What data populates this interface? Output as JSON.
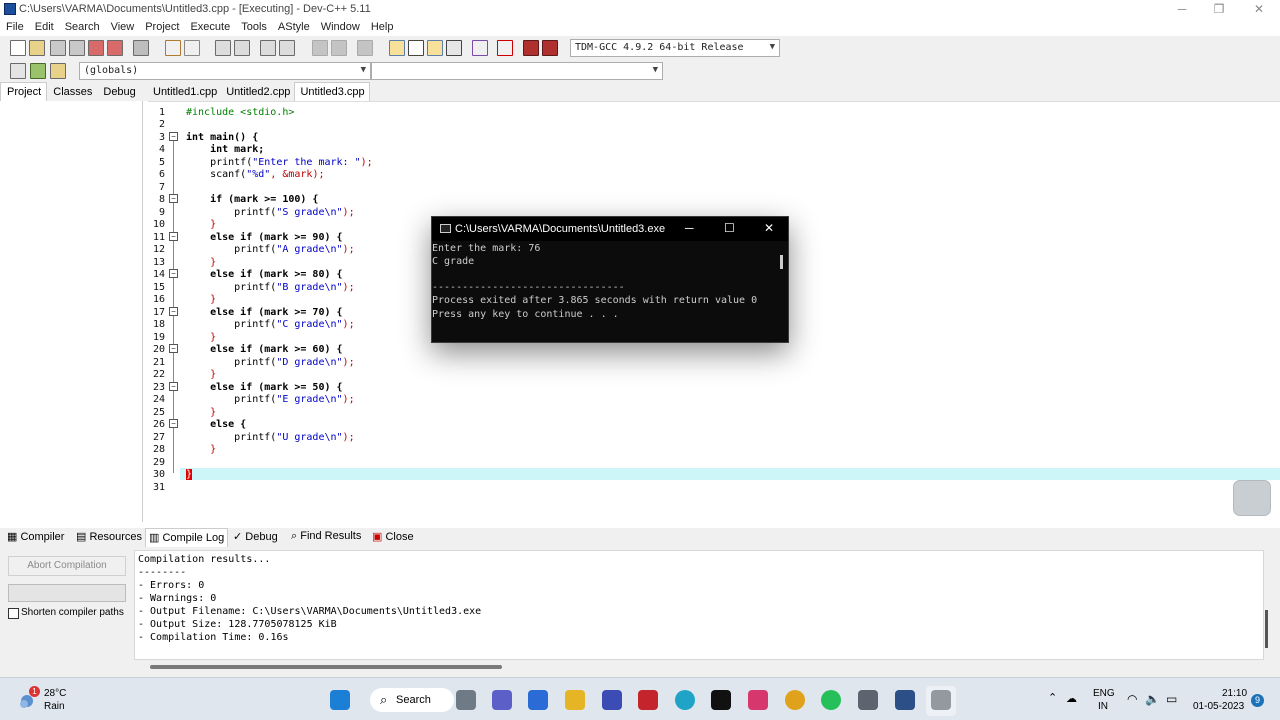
{
  "window": {
    "title": "C:\\Users\\VARMA\\Documents\\Untitled3.cpp - [Executing] - Dev-C++ 5.11",
    "minimize": "─",
    "maximize": "❐",
    "close": "✕"
  },
  "menu": [
    "File",
    "Edit",
    "Search",
    "View",
    "Project",
    "Execute",
    "Tools",
    "AStyle",
    "Window",
    "Help"
  ],
  "toolbar": {
    "compiler_select": "TDM-GCC 4.9.2 64-bit Release",
    "scope_select": "(globals)",
    "function_select": ""
  },
  "left_tabs": [
    "Project",
    "Classes",
    "Debug"
  ],
  "editor_tabs": [
    "Untitled1.cpp",
    "Untitled2.cpp",
    "Untitled3.cpp"
  ],
  "line_numbers": [
    "1",
    "2",
    "3",
    "4",
    "5",
    "6",
    "7",
    "8",
    "9",
    "10",
    "11",
    "12",
    "13",
    "14",
    "15",
    "16",
    "17",
    "18",
    "19",
    "20",
    "21",
    "22",
    "23",
    "24",
    "25",
    "26",
    "27",
    "28",
    "29",
    "30",
    "31"
  ],
  "code": {
    "l1": "#include <stdio.h>",
    "l3": "int main() {",
    "l4": "    int mark;",
    "l5a": "    printf(",
    "l5b": "\"Enter the mark: \"",
    "l5c": ");",
    "l6a": "    scanf(",
    "l6b": "\"%d\"",
    "l6c": ", &mark);",
    "l8": "    if (mark >= 100) {",
    "l9a": "        printf(",
    "l9b": "\"S grade\\n\"",
    "l9c": ");",
    "l10": "    }",
    "l11": "    else if (mark >= 90) {",
    "l12a": "        printf(",
    "l12b": "\"A grade\\n\"",
    "l12c": ");",
    "l13": "    }",
    "l14": "    else if (mark >= 80) {",
    "l15a": "        printf(",
    "l15b": "\"B grade\\n\"",
    "l15c": ");",
    "l16": "    }",
    "l17": "    else if (mark >= 70) {",
    "l18a": "        printf(",
    "l18b": "\"C grade\\n\"",
    "l18c": ");",
    "l19": "    }",
    "l20": "    else if (mark >= 60) {",
    "l21a": "        printf(",
    "l21b": "\"D grade\\n\"",
    "l21c": ");",
    "l22": "    }",
    "l23": "    else if (mark >= 50) {",
    "l24a": "        printf(",
    "l24b": "\"E grade\\n\"",
    "l24c": ");",
    "l25": "    }",
    "l26": "    else {",
    "l27a": "        printf(",
    "l27b": "\"U grade\\n\"",
    "l27c": ");",
    "l28": "    }",
    "l30": "}"
  },
  "bottom_tabs": [
    "Compiler",
    "Resources",
    "Compile Log",
    "Debug",
    "Find Results",
    "Close"
  ],
  "compile_panel": {
    "abort_label": "Abort Compilation",
    "shorten_label": "Shorten compiler paths",
    "log": [
      "Compilation results...",
      "--------",
      "- Errors: 0",
      "- Warnings: 0",
      "- Output Filename: C:\\Users\\VARMA\\Documents\\Untitled3.exe",
      "- Output Size: 128.7705078125 KiB",
      "- Compilation Time: 0.16s"
    ]
  },
  "console": {
    "title": "C:\\Users\\VARMA\\Documents\\Untitled3.exe",
    "lines": [
      "Enter the mark: 76",
      "C grade",
      "",
      "--------------------------------",
      "Process exited after 3.865 seconds with return value 0",
      "Press any key to continue . . ."
    ]
  },
  "taskbar": {
    "weather_temp": "28°C",
    "weather_cond": "Rain",
    "weather_badge": "1",
    "search_label": "Search",
    "lang_line1": "ENG",
    "lang_line2": "IN",
    "time": "21:10",
    "date": "01-05-2023",
    "notif_count": "9"
  },
  "colors": {
    "string": "#0000c8",
    "preprocessor": "#008000",
    "number": "#7a2c9e",
    "symbol": "#c00000",
    "current_line": "#ccf6f7"
  }
}
